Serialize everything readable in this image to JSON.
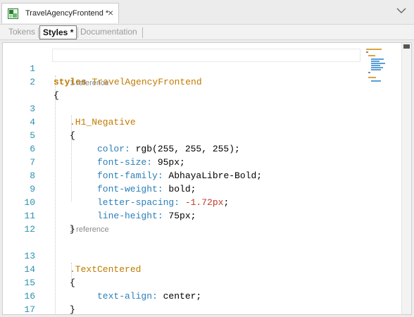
{
  "window": {
    "doc_tab_title": "TravelAgencyFrontend *",
    "close_glyph": "×",
    "doc_icon": "style-object-icon",
    "menu_icon": "chevron-down-icon"
  },
  "subtabs": [
    {
      "label": "Tokens",
      "active": false
    },
    {
      "label": "Styles *",
      "active": true
    },
    {
      "label": "Documentation",
      "active": false
    }
  ],
  "editor": {
    "codelens": [
      "1 reference",
      "1 reference"
    ],
    "lines": [
      {
        "n": "1",
        "text": "styles TravelAgencyFrontend"
      },
      {
        "n": "2",
        "text": "{"
      },
      {
        "n": "3",
        "text": ".H1_Negative"
      },
      {
        "n": "4",
        "text": "{"
      },
      {
        "n": "5",
        "prop": "color:",
        "value": " rgb(255, 255, 255);"
      },
      {
        "n": "6",
        "prop": "font-size:",
        "value": " 95px;"
      },
      {
        "n": "7",
        "prop": "font-family:",
        "value": " AbhayaLibre-Bold;"
      },
      {
        "n": "8",
        "prop": "font-weight:",
        "value": " bold;"
      },
      {
        "n": "9",
        "prop": "letter-spacing:",
        "value": " -1.72px",
        "tail": ";"
      },
      {
        "n": "10",
        "prop": "line-height:",
        "value": " 75px;"
      },
      {
        "n": "11",
        "text": "}"
      },
      {
        "n": "12",
        "text": ""
      },
      {
        "n": "13",
        "text": ".TextCentered"
      },
      {
        "n": "14",
        "text": "{"
      },
      {
        "n": "15",
        "prop": "text-align:",
        "value": " center;"
      },
      {
        "n": "16",
        "text": "}"
      },
      {
        "n": "17",
        "text": "}"
      }
    ],
    "keyword": "styles",
    "object_name": " TravelAgencyFrontend"
  },
  "colors": {
    "line_number": "#2b91af",
    "selector": "#c07a00",
    "property": "#2a7fb8",
    "negative_value": "#c0392b"
  }
}
